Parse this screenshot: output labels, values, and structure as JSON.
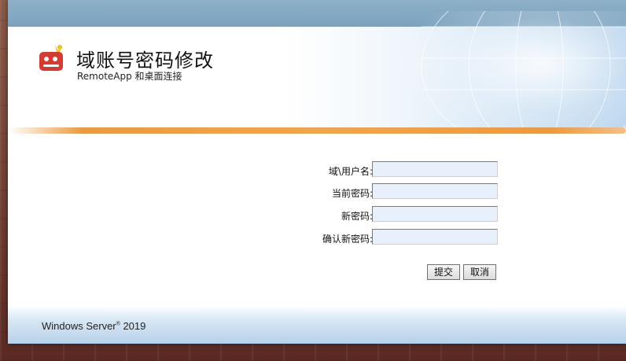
{
  "header": {
    "title": "域账号密码修改",
    "subtitle": "RemoteApp 和桌面连接",
    "logo_icon": "remoteapp-logo-icon"
  },
  "form": {
    "fields": [
      {
        "label": "域\\用户名:",
        "value": ""
      },
      {
        "label": "当前密码:",
        "value": ""
      },
      {
        "label": "新密码:",
        "value": ""
      },
      {
        "label": "确认新密码:",
        "value": ""
      }
    ],
    "submit_label": "提交",
    "cancel_label": "取消"
  },
  "footer": {
    "brand": "Windows Server",
    "version": "2019"
  },
  "colors": {
    "accent_orange": "#ef9a3a",
    "header_blue": "#7aa2bf",
    "input_bg": "#e8f0fb"
  }
}
